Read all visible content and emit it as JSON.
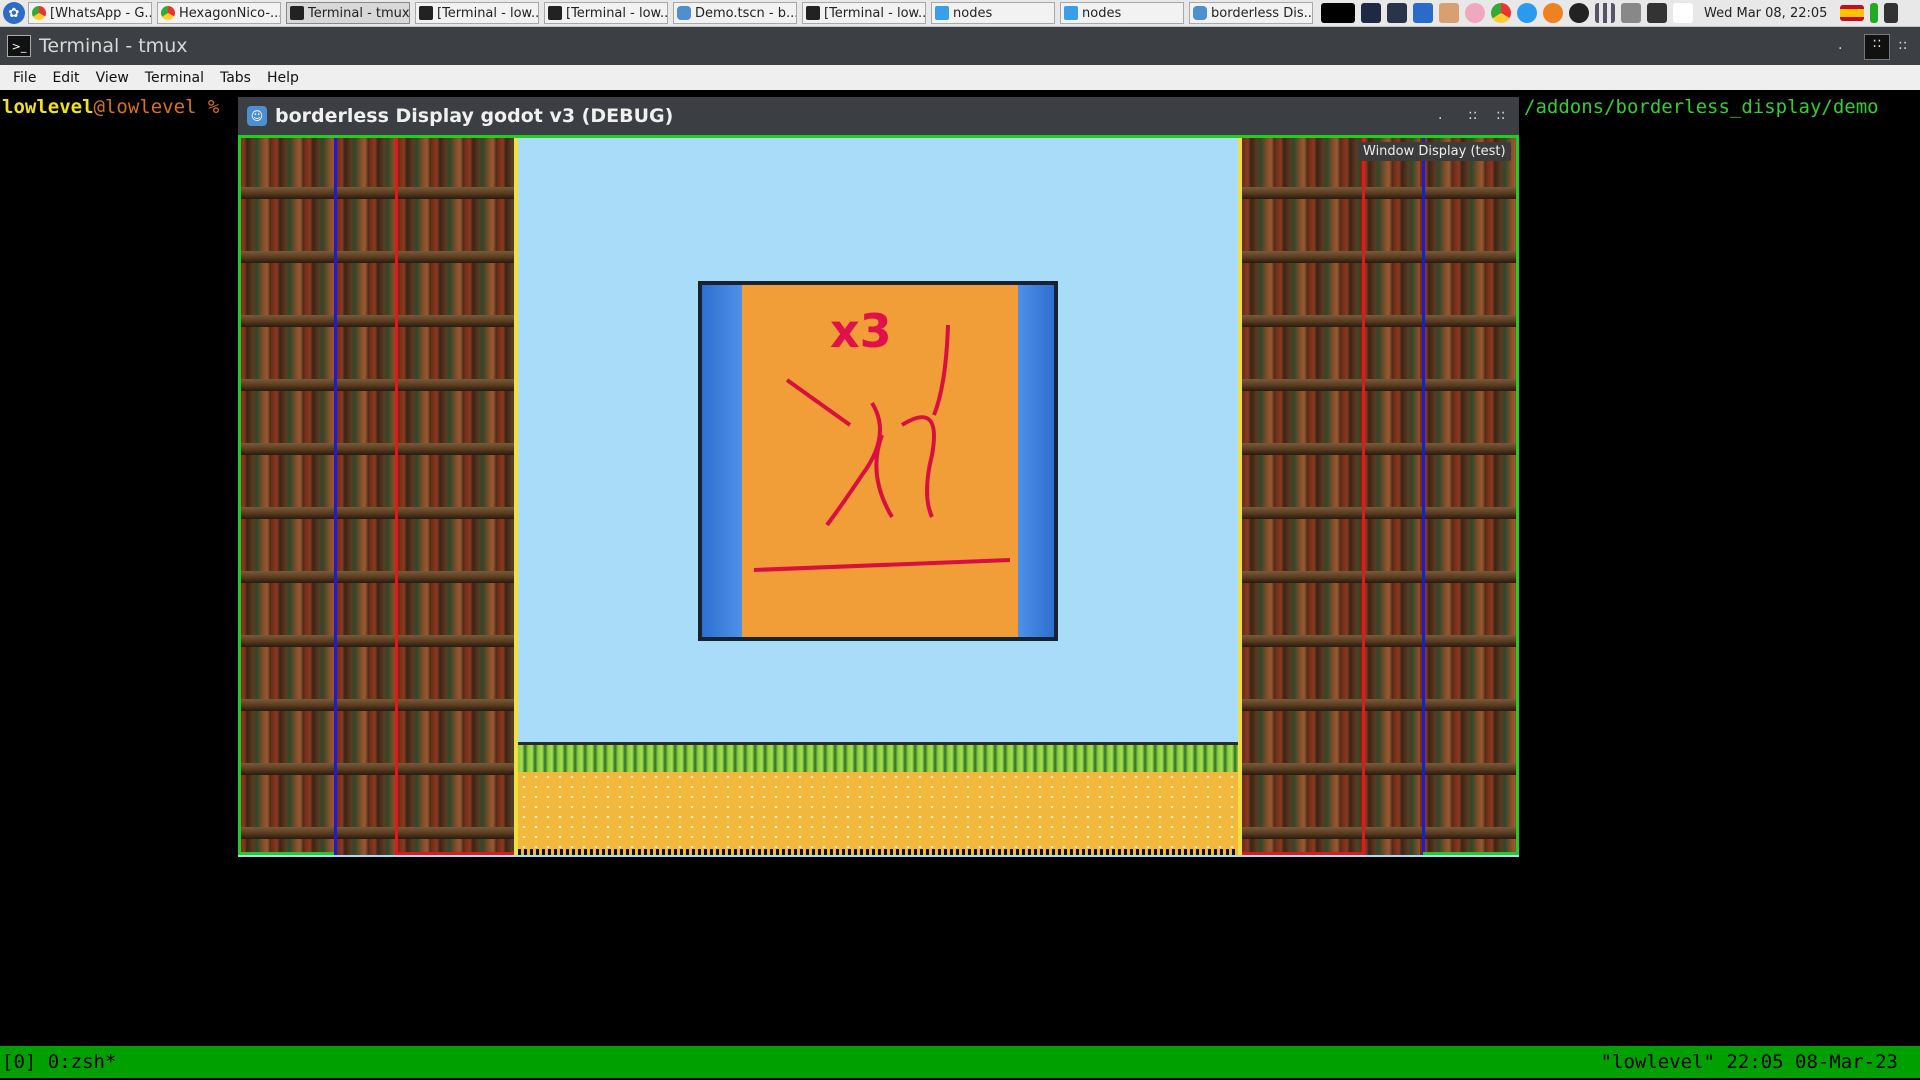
{
  "taskbar": {
    "tasks": [
      {
        "label": "[WhatsApp - G...",
        "icon": "chrome-icon"
      },
      {
        "label": "HexagonNico-...",
        "icon": "chrome-icon"
      },
      {
        "label": "Terminal - tmux",
        "icon": "terminal-icon"
      },
      {
        "label": "[Terminal - low...",
        "icon": "terminal-icon"
      },
      {
        "label": "[Terminal - low...",
        "icon": "terminal-icon"
      },
      {
        "label": "Demo.tscn - b...",
        "icon": "godot-icon"
      },
      {
        "label": "[Terminal - low...",
        "icon": "terminal-icon"
      },
      {
        "label": "nodes",
        "icon": "folder-icon"
      },
      {
        "label": "nodes",
        "icon": "folder-icon"
      },
      {
        "label": "borderless Dis...",
        "icon": "godot-icon"
      }
    ],
    "clock": "Wed Mar 08, 22:05"
  },
  "terminal": {
    "title": "Terminal - tmux",
    "menu": [
      "File",
      "Edit",
      "View",
      "Terminal",
      "Tabs",
      "Help"
    ],
    "prompt_user": "lowlevel",
    "prompt_host": "@lowlevel %",
    "path_text": "/addons/borderless_display/demo",
    "status_left": "[0] 0:zsh*",
    "status_right": "\"lowlevel\" 22:05 08-Mar-23"
  },
  "godot": {
    "title": "borderless Display godot v3 (DEBUG)",
    "tooltip": "Window Display (test)",
    "picture_label": "x3"
  },
  "colors": {
    "frame_green": "#22cc22",
    "frame_blue": "#1a1ae0",
    "frame_red": "#e01a1a",
    "frame_yellow": "#f0e040",
    "sky": "#a9dcf9",
    "tmux_green": "#00a000"
  }
}
